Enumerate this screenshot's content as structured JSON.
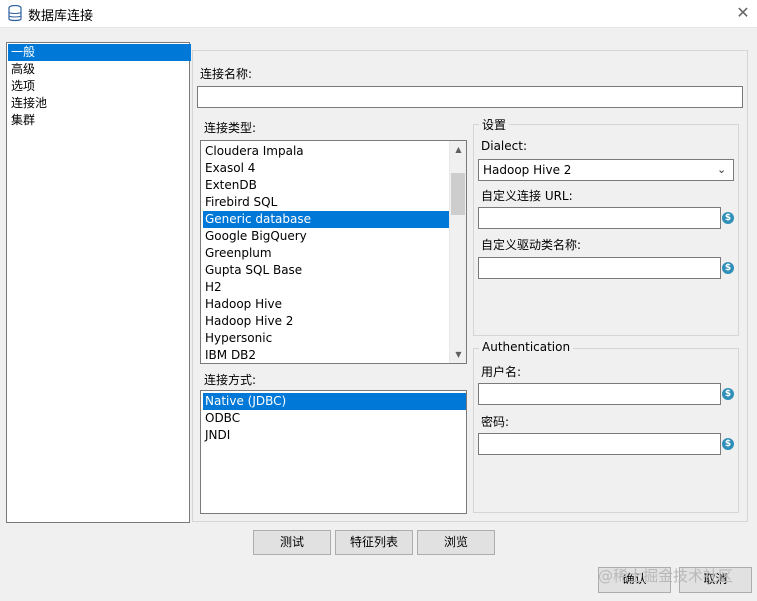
{
  "window": {
    "title": "数据库连接",
    "close_glyph": "✕"
  },
  "sidebar": {
    "items": [
      {
        "label": "一般",
        "selected": true
      },
      {
        "label": "高级",
        "selected": false
      },
      {
        "label": "选项",
        "selected": false
      },
      {
        "label": "连接池",
        "selected": false
      },
      {
        "label": "集群",
        "selected": false
      }
    ]
  },
  "general": {
    "connection_name_label": "连接名称:",
    "connection_name_value": "",
    "connection_type_label": "连接类型:",
    "connection_types": [
      "Cloudera Impala",
      "Exasol 4",
      "ExtenDB",
      "Firebird SQL",
      "Generic database",
      "Google BigQuery",
      "Greenplum",
      "Gupta SQL Base",
      "H2",
      "Hadoop Hive",
      "Hadoop Hive 2",
      "Hypersonic",
      "IBM DB2"
    ],
    "connection_type_selected": "Generic database",
    "access_label": "连接方式:",
    "access_methods": [
      "Native (JDBC)",
      "ODBC",
      "JNDI"
    ],
    "access_selected": "Native (JDBC)"
  },
  "settings": {
    "legend": "设置",
    "dialect_label": "Dialect:",
    "dialect_value": "Hadoop Hive 2",
    "custom_url_label": "自定义连接 URL:",
    "custom_url_value": "",
    "custom_driver_label": "自定义驱动类名称:",
    "custom_driver_value": ""
  },
  "authentication": {
    "legend": "Authentication",
    "username_label": "用户名:",
    "username_value": "",
    "password_label": "密码:",
    "password_value": ""
  },
  "buttons": {
    "test": "测试",
    "feature_list": "特征列表",
    "browse": "浏览",
    "ok": "确认",
    "cancel": "取消"
  },
  "variable_icon_glyph": "$",
  "watermark": "@稀土掘金技术社区"
}
